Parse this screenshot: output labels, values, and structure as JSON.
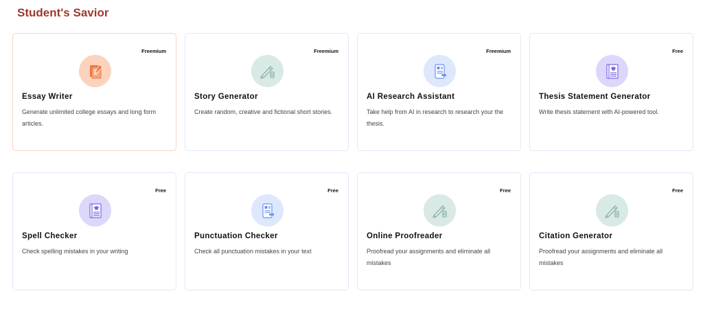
{
  "page": {
    "title": "Student's Savior"
  },
  "cards": [
    {
      "title": "Essay Writer",
      "description": "Generate unlimited college essays and long form articles.",
      "badge": "Freemium",
      "icon": "essay-icon",
      "icon_bg": "#fbd3bc",
      "icon_color": "#ec7a45",
      "active": true
    },
    {
      "title": "Story Generator",
      "description": "Create random, creative and fictional short stories.",
      "badge": "Freemium",
      "icon": "pencil-icon",
      "icon_bg": "#d8e9e6",
      "icon_color": "#8fb3ae",
      "active": false
    },
    {
      "title": "AI Research Assistant",
      "description": "Take help from AI in research to research your the thesis.",
      "badge": "Freemium",
      "icon": "research-icon",
      "icon_bg": "#dde8fd",
      "icon_color": "#6c92ef",
      "active": false
    },
    {
      "title": "Thesis Statement Generator",
      "description": "Write thesis statement with AI-powered tool.",
      "badge": "Free",
      "icon": "book-icon",
      "icon_bg": "#dcd8fb",
      "icon_color": "#7a67e6",
      "active": false
    },
    {
      "title": "Spell Checker",
      "description": "Check spelling mistakes in your writing",
      "badge": "Free",
      "icon": "book-icon",
      "icon_bg": "#dcd8fb",
      "icon_color": "#7a67e6",
      "active": false
    },
    {
      "title": "Punctuation Checker",
      "description": "Check all punctuation mistakes in your text",
      "badge": "Free",
      "icon": "research-icon",
      "icon_bg": "#dde8fd",
      "icon_color": "#6c92ef",
      "active": false
    },
    {
      "title": "Online Proofreader",
      "description": "Proofread your assignments and eliminate all mistakes",
      "badge": "Free",
      "icon": "pencil-icon",
      "icon_bg": "#d8e9e6",
      "icon_color": "#8fb3ae",
      "active": false
    },
    {
      "title": "Citation Generator",
      "description": "Proofread your assignments and eliminate all mistakes",
      "badge": "Free",
      "icon": "pencil-icon",
      "icon_bg": "#d8e9e6",
      "icon_color": "#8fb3ae",
      "active": false
    }
  ]
}
